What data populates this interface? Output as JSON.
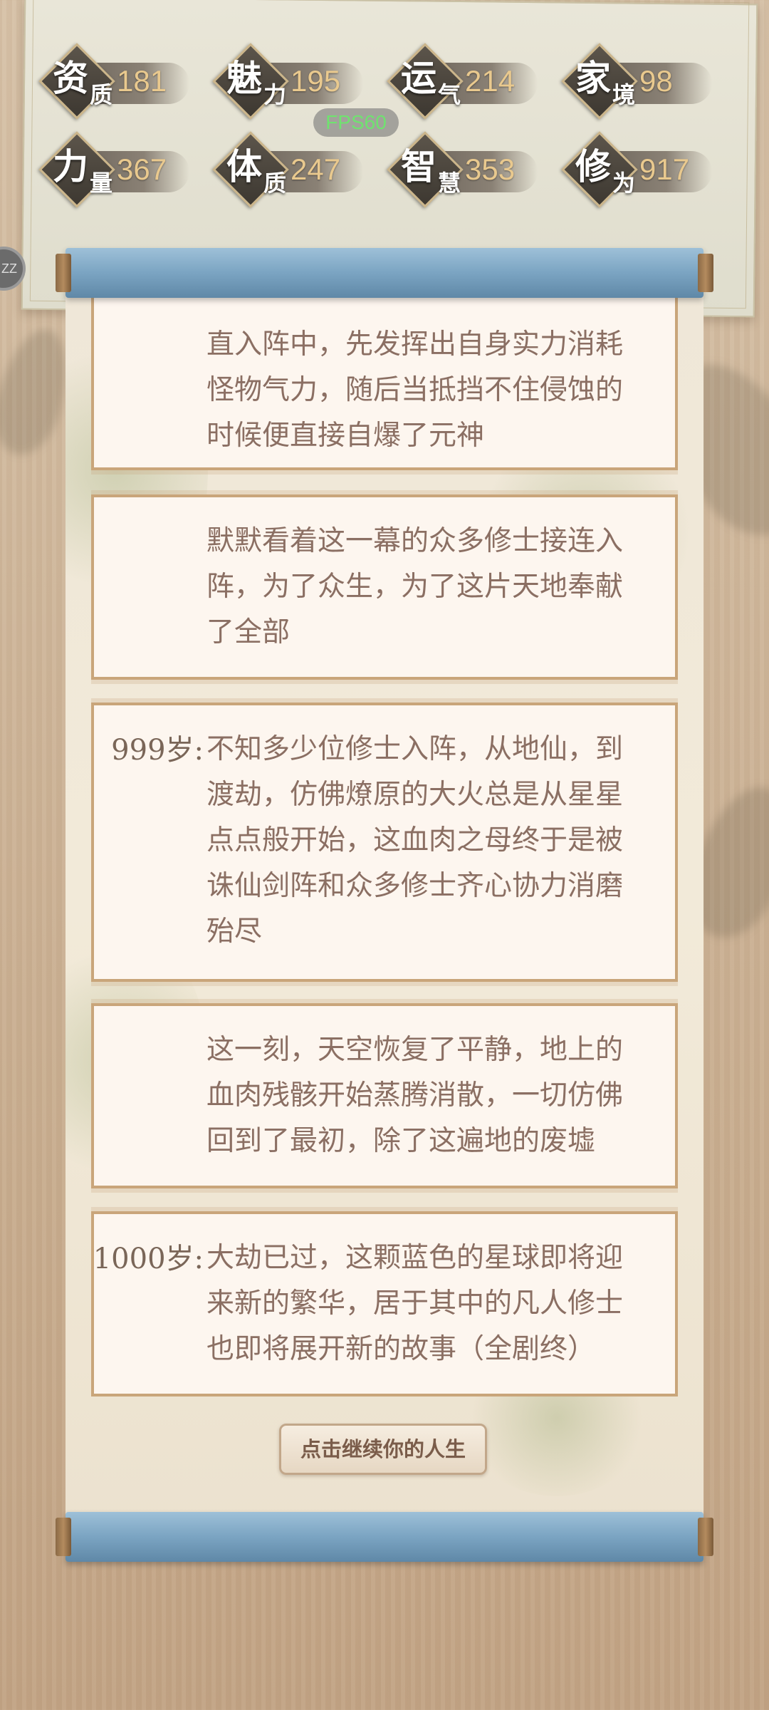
{
  "stats": [
    {
      "big": "资",
      "small": "质",
      "value": "181"
    },
    {
      "big": "魅",
      "small": "力",
      "value": "195"
    },
    {
      "big": "运",
      "small": "气",
      "value": "214"
    },
    {
      "big": "家",
      "small": "境",
      "value": "98"
    },
    {
      "big": "力",
      "small": "量",
      "value": "367"
    },
    {
      "big": "体",
      "small": "质",
      "value": "247"
    },
    {
      "big": "智",
      "small": "慧",
      "value": "353"
    },
    {
      "big": "修",
      "small": "为",
      "value": "917"
    }
  ],
  "fps": "FPS60",
  "side_button": "ZZ",
  "entries": [
    {
      "age": "",
      "text": "直入阵中，先发挥出自身实力消耗怪物气力，随后当抵挡不住侵蚀的时候便直接自爆了元神"
    },
    {
      "age": "",
      "text": "默默看着这一幕的众多修士接连入阵，为了众生，为了这片天地奉献了全部"
    },
    {
      "age": "999岁:",
      "text": "不知多少位修士入阵，从地仙，到渡劫，仿佛燎原的大火总是从星星点点般开始，这血肉之母终于是被诛仙剑阵和众多修士齐心协力消磨殆尽"
    },
    {
      "age": "",
      "text": "这一刻，天空恢复了平静，地上的血肉残骸开始蒸腾消散，一切仿佛回到了最初，除了这遍地的废墟"
    },
    {
      "age": "1000岁:",
      "text": "大劫已过，这颗蓝色的星球即将迎来新的繁华，居于其中的凡人修士也即将展开新的故事（全剧终）"
    }
  ],
  "continue_label": "点击继续你的人生",
  "colors": {
    "accent_gold": "#e9c98e",
    "scroll_rod": "#7ba4c2",
    "entry_border": "#c9a57a",
    "entry_text": "#8b6f63",
    "fps_green": "#6fe36f"
  }
}
